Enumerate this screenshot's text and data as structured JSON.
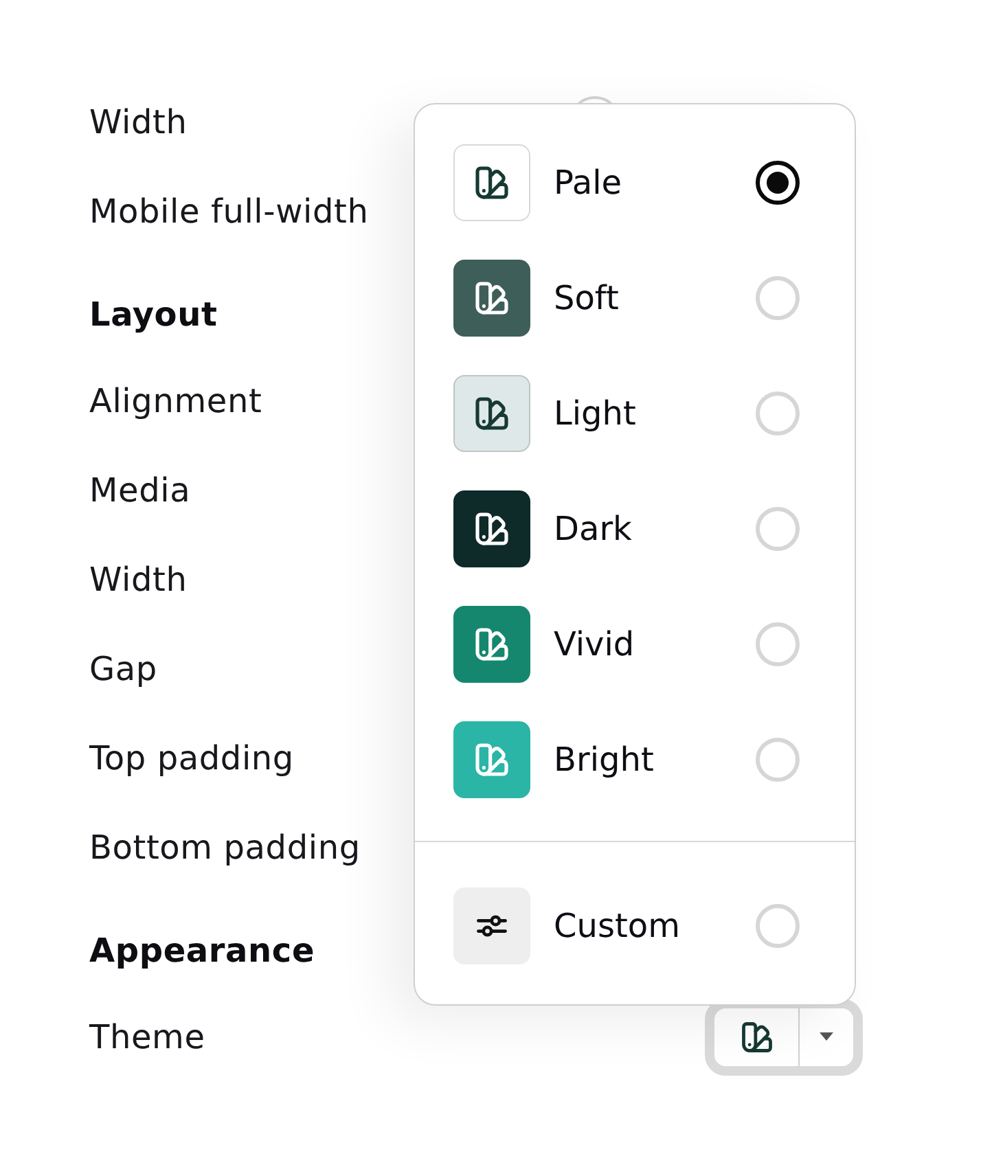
{
  "settings": [
    {
      "kind": "slider",
      "label": "Width"
    },
    {
      "kind": "setting",
      "label": "Mobile full-width"
    },
    {
      "kind": "heading",
      "label": "Layout"
    },
    {
      "kind": "setting",
      "label": "Alignment"
    },
    {
      "kind": "setting",
      "label": "Media"
    },
    {
      "kind": "setting",
      "label": "Width"
    },
    {
      "kind": "setting",
      "label": "Gap"
    },
    {
      "kind": "setting",
      "label": "Top padding"
    },
    {
      "kind": "setting",
      "label": "Bottom padding"
    },
    {
      "kind": "heading",
      "label": "Appearance"
    },
    {
      "kind": "picker",
      "label": "Theme"
    }
  ],
  "theme_menu": {
    "options": [
      {
        "kind": "preset",
        "label": "Pale",
        "color": "#ffffff",
        "selected": true
      },
      {
        "kind": "preset",
        "label": "Soft",
        "color": "#3e5e59",
        "selected": false
      },
      {
        "kind": "preset",
        "label": "Light",
        "color": "#dfe8e8",
        "selected": false
      },
      {
        "kind": "preset",
        "label": "Dark",
        "color": "#0e2a29",
        "selected": false
      },
      {
        "kind": "preset",
        "label": "Vivid",
        "color": "#15876f",
        "selected": false
      },
      {
        "kind": "preset",
        "label": "Bright",
        "color": "#2ab5a7",
        "selected": false
      },
      {
        "kind": "custom",
        "label": "Custom",
        "selected": false
      }
    ]
  }
}
